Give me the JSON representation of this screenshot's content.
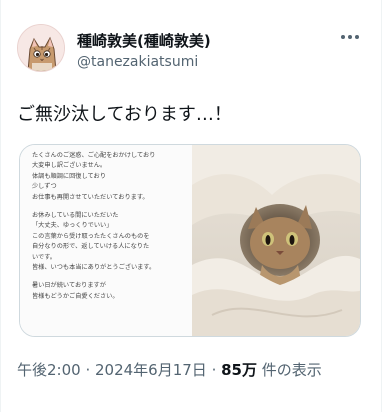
{
  "header": {
    "display_name": "種崎敦美(種崎敦美)",
    "handle": "@tanezakiatsumi",
    "more_icon": "more-horizontal-icon"
  },
  "tweet": {
    "text": "ご無沙汰しております…！"
  },
  "media": {
    "note_lines": [
      "たくさんのご迷惑、ご心配をおかけしており",
      "大変申し訳ございません。",
      "体調も順調に回復しており",
      "少しずつ",
      "お仕事も再開させていただいております。",
      "",
      "お休みしている間にいただいた",
      "「大丈夫、ゆっくりでいい」",
      "この言葉から受け取ったたくさんのものを",
      "自分なりの形で、返していける人になりた",
      "いです。",
      "皆様、いつも本当にありがとうございます。",
      "",
      "暑い日が続いておりますが",
      "皆様もどうかご自愛ください。"
    ],
    "photo_subject": "cat-under-blanket"
  },
  "meta": {
    "time": "午後2:00",
    "sep1": " · ",
    "date": "2024年6月17日",
    "sep2": " · ",
    "views_count": "85万",
    "views_label": " 件の表示"
  }
}
